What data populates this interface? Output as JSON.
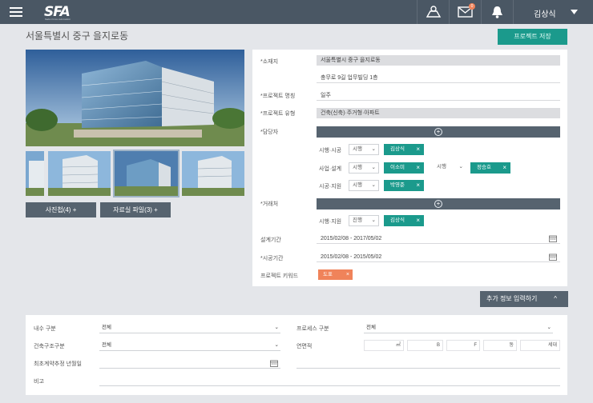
{
  "header": {
    "logo": "SFA",
    "logo_sub": "Sales Force Automation",
    "notification_count": "0",
    "user": "김상식"
  },
  "page": {
    "title": "서울특별시 중구 을지로동"
  },
  "toolbar": {
    "save_label": "프로젝트 저장"
  },
  "photos": {
    "gallery_button": "사진첩(4) +",
    "files_button": "자료실 파일(3) +"
  },
  "info": {
    "address_label": "*소재지",
    "address_value": "서울특별시 중구 을지로동",
    "address_detail": "충무로 9길 업무빌딩 1층",
    "name_label": "*프로젝트 명칭",
    "name_value": "일주",
    "type_label": "*프로젝트 유형",
    "type_value": "건축(신축)·주거형·아파트",
    "manager_label": "*담당자",
    "client_label": "*거래처",
    "design_period_label": "설계기간",
    "design_period_value": "2015/02/08 - 2017/05/02",
    "build_period_label": "*시공기간",
    "build_period_value": "2015/02/08 - 2015/05/02",
    "keyword_label": "프로젝트 키워드",
    "keyword_chip": "도표"
  },
  "managers": [
    {
      "role": "시행·시공",
      "sel": "시행",
      "name": "김상식"
    },
    {
      "role": "사업·설계",
      "sel": "시행",
      "name": "이소미",
      "role2": "시행",
      "name2": "정승호"
    },
    {
      "role": "시공·지원",
      "sel": "시행",
      "name": "박영준"
    }
  ],
  "clients": [
    {
      "role": "시행·지원",
      "sel": "진행",
      "name": "김상식"
    }
  ],
  "more": {
    "label": "추가 정보 입력하기"
  },
  "extra": {
    "domestic_label": "내수 구분",
    "domestic_value": "전체",
    "process_label": "프로세스 구분",
    "process_value": "전체",
    "structure_label": "건축구조구분",
    "structure_value": "전체",
    "area_label": "연면적",
    "area_units": [
      "㎡",
      "B",
      "F",
      "동",
      "세대"
    ],
    "contract_label": "최초계약추정 년월일",
    "note_label": "비고"
  }
}
